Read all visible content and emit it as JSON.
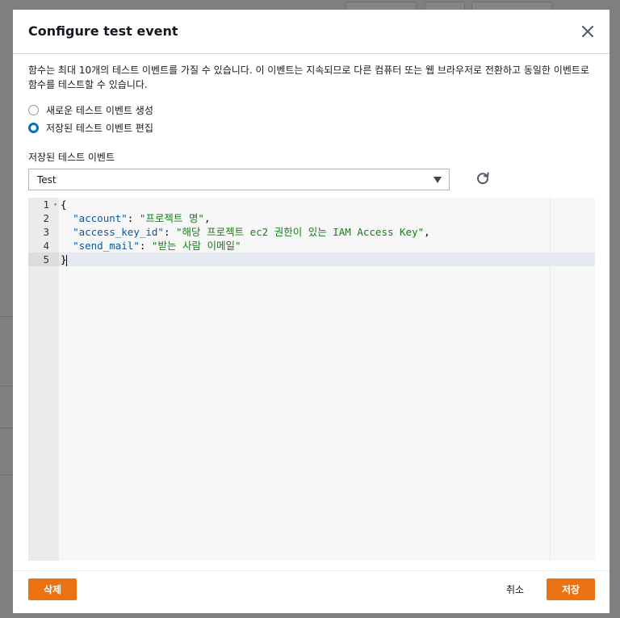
{
  "modal": {
    "title": "Configure test event",
    "description": "함수는 최대 10개의 테스트 이벤트를 가질 수 있습니다. 이 이벤트는 지속되므로 다른 컴퓨터 또는 웹 브라우저로 전환하고 동일한 이벤트로 함수를 테스트할 수 있습니다.",
    "options": [
      {
        "label": "새로운 테스트 이벤트 생성",
        "selected": false
      },
      {
        "label": "저장된 테스트 이벤트 편집",
        "selected": true
      }
    ],
    "saved_event_label": "저장된 테스트 이벤트",
    "saved_event_value": "Test",
    "editor": {
      "line_numbers": [
        "1",
        "2",
        "3",
        "4",
        "5"
      ],
      "lines": [
        {
          "indent": "",
          "key": "",
          "value": "",
          "raw": "{"
        },
        {
          "indent": "  ",
          "key": "\"account\"",
          "value": "\"프로젝트 명\"",
          "suffix": ","
        },
        {
          "indent": "  ",
          "key": "\"access_key_id\"",
          "value": "\"해당 프로젝트 ec2 권한이 있는 IAM Access Key\"",
          "suffix": ","
        },
        {
          "indent": "  ",
          "key": "\"send_mail\"",
          "value": "\"받는 사람 이메일\"",
          "suffix": ""
        },
        {
          "indent": "",
          "key": "",
          "value": "",
          "raw": "}"
        }
      ],
      "active_line": 5
    },
    "buttons": {
      "delete": "삭제",
      "cancel": "취소",
      "save": "저장"
    }
  },
  "colors": {
    "accent": "#ec7211",
    "radio_selected": "#0073bb"
  },
  "icons": {
    "close": "close-icon",
    "refresh": "refresh-icon",
    "dropdown": "caret-down-icon"
  }
}
